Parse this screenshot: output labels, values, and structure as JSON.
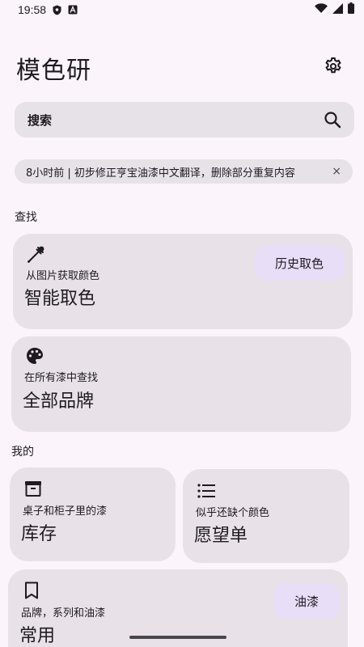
{
  "status_bar": {
    "time": "19:58",
    "left_icons": [
      "shield-icon",
      "a-badge-icon"
    ],
    "right_icons": [
      "wifi-icon",
      "signal-icon",
      "battery-icon"
    ]
  },
  "app": {
    "title": "模色研",
    "settings_icon": "gear-icon"
  },
  "search": {
    "label": "搜索",
    "icon": "search-icon"
  },
  "notice": {
    "text": "8小时前 | 初步修正亨宝油漆中文翻译，删除部分重复内容",
    "close": "×"
  },
  "sections": {
    "find": "查找",
    "mine": "我的"
  },
  "cards": {
    "smart_pick": {
      "icon": "eyedropper-icon",
      "subtitle": "从图片获取颜色",
      "title": "智能取色",
      "chip": "历史取色"
    },
    "all_brands": {
      "icon": "palette-icon",
      "subtitle": "在所有漆中查找",
      "title": "全部品牌"
    },
    "inventory": {
      "icon": "archive-icon",
      "subtitle": "桌子和柜子里的漆",
      "title": "库存"
    },
    "wishlist": {
      "icon": "list-icon",
      "subtitle": "似乎还缺个颜色",
      "title": "愿望单"
    },
    "favorites": {
      "icon": "bookmark-icon",
      "subtitle": "品牌，系列和油漆",
      "title": "常用",
      "chip": "油漆"
    }
  },
  "colors": {
    "background": "#fbf5fb",
    "card": "#e8e2e8",
    "chip": "#e8def8",
    "text": "#1d1b20"
  }
}
